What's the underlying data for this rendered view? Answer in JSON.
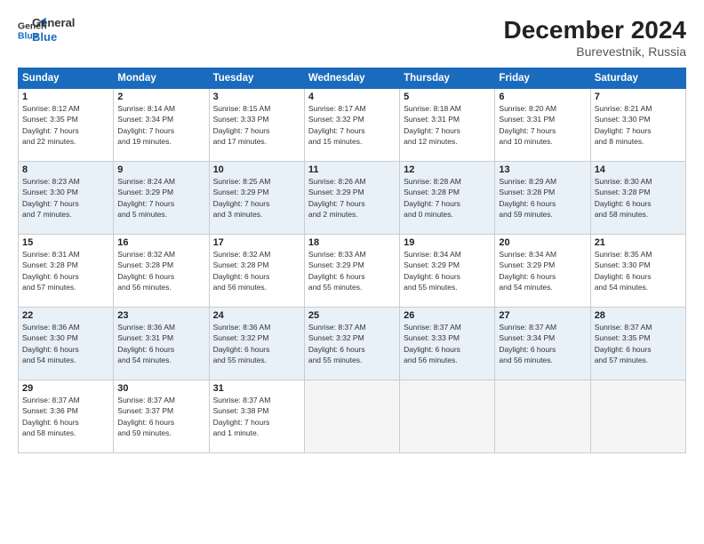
{
  "header": {
    "logo_general": "General",
    "logo_blue": "Blue",
    "month_year": "December 2024",
    "location": "Burevestnik, Russia"
  },
  "weekdays": [
    "Sunday",
    "Monday",
    "Tuesday",
    "Wednesday",
    "Thursday",
    "Friday",
    "Saturday"
  ],
  "weeks": [
    [
      {
        "day": "1",
        "info": "Sunrise: 8:12 AM\nSunset: 3:35 PM\nDaylight: 7 hours\nand 22 minutes."
      },
      {
        "day": "2",
        "info": "Sunrise: 8:14 AM\nSunset: 3:34 PM\nDaylight: 7 hours\nand 19 minutes."
      },
      {
        "day": "3",
        "info": "Sunrise: 8:15 AM\nSunset: 3:33 PM\nDaylight: 7 hours\nand 17 minutes."
      },
      {
        "day": "4",
        "info": "Sunrise: 8:17 AM\nSunset: 3:32 PM\nDaylight: 7 hours\nand 15 minutes."
      },
      {
        "day": "5",
        "info": "Sunrise: 8:18 AM\nSunset: 3:31 PM\nDaylight: 7 hours\nand 12 minutes."
      },
      {
        "day": "6",
        "info": "Sunrise: 8:20 AM\nSunset: 3:31 PM\nDaylight: 7 hours\nand 10 minutes."
      },
      {
        "day": "7",
        "info": "Sunrise: 8:21 AM\nSunset: 3:30 PM\nDaylight: 7 hours\nand 8 minutes."
      }
    ],
    [
      {
        "day": "8",
        "info": "Sunrise: 8:23 AM\nSunset: 3:30 PM\nDaylight: 7 hours\nand 7 minutes."
      },
      {
        "day": "9",
        "info": "Sunrise: 8:24 AM\nSunset: 3:29 PM\nDaylight: 7 hours\nand 5 minutes."
      },
      {
        "day": "10",
        "info": "Sunrise: 8:25 AM\nSunset: 3:29 PM\nDaylight: 7 hours\nand 3 minutes."
      },
      {
        "day": "11",
        "info": "Sunrise: 8:26 AM\nSunset: 3:29 PM\nDaylight: 7 hours\nand 2 minutes."
      },
      {
        "day": "12",
        "info": "Sunrise: 8:28 AM\nSunset: 3:28 PM\nDaylight: 7 hours\nand 0 minutes."
      },
      {
        "day": "13",
        "info": "Sunrise: 8:29 AM\nSunset: 3:28 PM\nDaylight: 6 hours\nand 59 minutes."
      },
      {
        "day": "14",
        "info": "Sunrise: 8:30 AM\nSunset: 3:28 PM\nDaylight: 6 hours\nand 58 minutes."
      }
    ],
    [
      {
        "day": "15",
        "info": "Sunrise: 8:31 AM\nSunset: 3:28 PM\nDaylight: 6 hours\nand 57 minutes."
      },
      {
        "day": "16",
        "info": "Sunrise: 8:32 AM\nSunset: 3:28 PM\nDaylight: 6 hours\nand 56 minutes."
      },
      {
        "day": "17",
        "info": "Sunrise: 8:32 AM\nSunset: 3:28 PM\nDaylight: 6 hours\nand 56 minutes."
      },
      {
        "day": "18",
        "info": "Sunrise: 8:33 AM\nSunset: 3:29 PM\nDaylight: 6 hours\nand 55 minutes."
      },
      {
        "day": "19",
        "info": "Sunrise: 8:34 AM\nSunset: 3:29 PM\nDaylight: 6 hours\nand 55 minutes."
      },
      {
        "day": "20",
        "info": "Sunrise: 8:34 AM\nSunset: 3:29 PM\nDaylight: 6 hours\nand 54 minutes."
      },
      {
        "day": "21",
        "info": "Sunrise: 8:35 AM\nSunset: 3:30 PM\nDaylight: 6 hours\nand 54 minutes."
      }
    ],
    [
      {
        "day": "22",
        "info": "Sunrise: 8:36 AM\nSunset: 3:30 PM\nDaylight: 6 hours\nand 54 minutes."
      },
      {
        "day": "23",
        "info": "Sunrise: 8:36 AM\nSunset: 3:31 PM\nDaylight: 6 hours\nand 54 minutes."
      },
      {
        "day": "24",
        "info": "Sunrise: 8:36 AM\nSunset: 3:32 PM\nDaylight: 6 hours\nand 55 minutes."
      },
      {
        "day": "25",
        "info": "Sunrise: 8:37 AM\nSunset: 3:32 PM\nDaylight: 6 hours\nand 55 minutes."
      },
      {
        "day": "26",
        "info": "Sunrise: 8:37 AM\nSunset: 3:33 PM\nDaylight: 6 hours\nand 56 minutes."
      },
      {
        "day": "27",
        "info": "Sunrise: 8:37 AM\nSunset: 3:34 PM\nDaylight: 6 hours\nand 56 minutes."
      },
      {
        "day": "28",
        "info": "Sunrise: 8:37 AM\nSunset: 3:35 PM\nDaylight: 6 hours\nand 57 minutes."
      }
    ],
    [
      {
        "day": "29",
        "info": "Sunrise: 8:37 AM\nSunset: 3:36 PM\nDaylight: 6 hours\nand 58 minutes."
      },
      {
        "day": "30",
        "info": "Sunrise: 8:37 AM\nSunset: 3:37 PM\nDaylight: 6 hours\nand 59 minutes."
      },
      {
        "day": "31",
        "info": "Sunrise: 8:37 AM\nSunset: 3:38 PM\nDaylight: 7 hours\nand 1 minute."
      },
      {
        "day": "",
        "info": ""
      },
      {
        "day": "",
        "info": ""
      },
      {
        "day": "",
        "info": ""
      },
      {
        "day": "",
        "info": ""
      }
    ]
  ]
}
